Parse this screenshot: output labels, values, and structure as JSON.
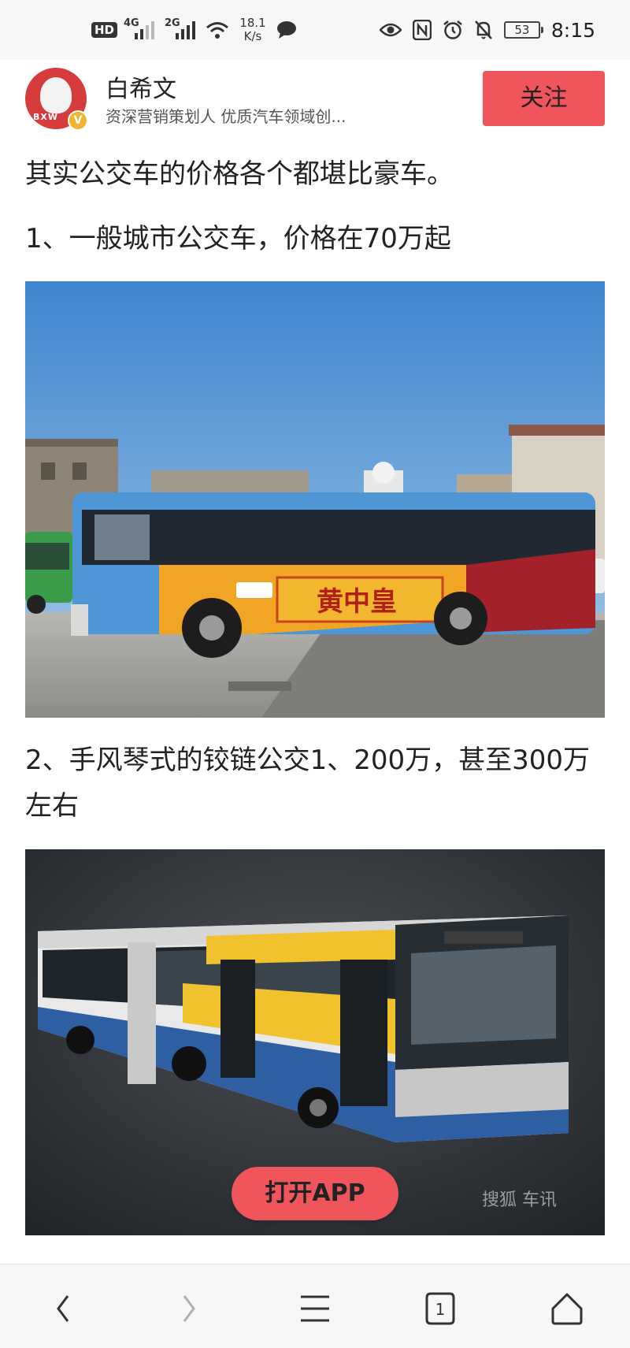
{
  "status_bar": {
    "hd_label": "HD",
    "sim1_label": "4G",
    "sim2_label": "2G",
    "net_speed_value": "18.1",
    "net_speed_unit": "K/s",
    "battery_level": "53",
    "time": "8:15",
    "icons": [
      "hd-icon",
      "signal-4g-icon",
      "signal-2g-icon",
      "wifi-icon",
      "chat-bubble-icon",
      "eye-icon",
      "nfc-icon",
      "alarm-icon",
      "mute-bell-icon",
      "battery-icon"
    ]
  },
  "author": {
    "name": "白希文",
    "description": "资深营销策划人 优质汽车领域创...",
    "avatar_text": "BXW",
    "verified_badge": "V",
    "follow_label": "关注"
  },
  "article": {
    "paragraph_1": "其实公交车的价格各个都堪比豪车。",
    "paragraph_2": "1、一般城市公交车，价格在70万起",
    "paragraph_3": "2、手风琴式的铰链公交1、200万，甚至300万左右",
    "photo_1_sign_text": "黄中皇",
    "photo_2_watermark": "搜狐 车讯"
  },
  "open_app": {
    "label": "打开APP"
  },
  "navbar": {
    "tab_count": "1",
    "icons": [
      "back-icon",
      "forward-icon",
      "menu-icon",
      "tabs-icon",
      "home-icon"
    ]
  },
  "colors": {
    "accent": "#f0555b",
    "badge": "#f2b531"
  }
}
